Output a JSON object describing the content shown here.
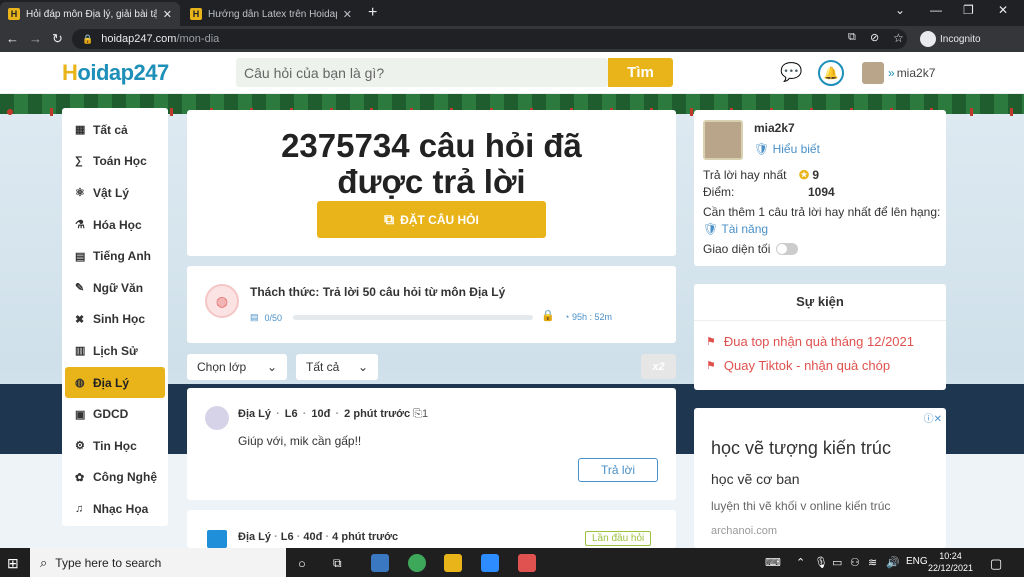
{
  "browser": {
    "tabs": [
      {
        "title": "Hỏi đáp môn Địa lý, giải bài tập môn Địa lý",
        "close": "✕"
      },
      {
        "title": "Hướng dẫn Latex trên Hoidap247",
        "close": "✕"
      }
    ],
    "new_tab": "+",
    "url_host": "hoidap247.com",
    "url_path": "/mon-dia",
    "profile_label": "Incognito"
  },
  "header": {
    "logo_h": "H",
    "logo_rest": "oidap247",
    "search_placeholder": "Câu hỏi của bạn là gì?",
    "search_button": "Tìm",
    "username": "mia2k7"
  },
  "sidebar": {
    "items": [
      {
        "label": "Tất cả",
        "icon": "grid-icon",
        "glyph": "▦"
      },
      {
        "label": "Toán Học",
        "icon": "math-icon",
        "glyph": "∑"
      },
      {
        "label": "Vật Lý",
        "icon": "physics-icon",
        "glyph": "⚛"
      },
      {
        "label": "Hóa Học",
        "icon": "flask-icon",
        "glyph": "⚗"
      },
      {
        "label": "Tiếng Anh",
        "icon": "english-icon",
        "glyph": "▤"
      },
      {
        "label": "Ngữ Văn",
        "icon": "pen-icon",
        "glyph": "✎"
      },
      {
        "label": "Sinh Học",
        "icon": "dna-icon",
        "glyph": "✖"
      },
      {
        "label": "Lịch Sử",
        "icon": "book-icon",
        "glyph": "▥"
      },
      {
        "label": "Địa Lý",
        "icon": "globe-icon",
        "glyph": "◍"
      },
      {
        "label": "GDCD",
        "icon": "civics-icon",
        "glyph": "▣"
      },
      {
        "label": "Tin Học",
        "icon": "computer-icon",
        "glyph": "⚙"
      },
      {
        "label": "Công Nghệ",
        "icon": "tech-icon",
        "glyph": "✿"
      },
      {
        "label": "Nhạc Họa",
        "icon": "music-icon",
        "glyph": "♫"
      }
    ],
    "active_index": 8
  },
  "hero": {
    "count_line1": "2375734 câu hỏi đã",
    "count_line2": "được trả lời",
    "ask_button": "ĐẶT CÂU HỎI"
  },
  "challenge": {
    "title": "Thách thức: Trả lời 50 câu hỏi  từ môn Địa Lý",
    "progress_text": "0/50",
    "progress": 0,
    "time_left": "95h : 52m"
  },
  "filters": {
    "grade": "Chọn lớp",
    "scope": "Tất cả",
    "multiplier": "x2"
  },
  "questions": [
    {
      "subject": "Địa Lý",
      "grade": "L6",
      "points": "10đ",
      "time": "2 phút trước",
      "attachments": "1",
      "text": "Giúp với, mik cần gấp!!",
      "reply_button": "Trả lời"
    },
    {
      "subject": "Địa Lý",
      "grade": "L6",
      "points": "40đ",
      "time": "4 phút trước",
      "badge": "Lần đầu hỏi"
    }
  ],
  "profile": {
    "name": "mia2k7",
    "badge": "Hiểu biết",
    "best_answers_label": "Trả lời hay nhất",
    "best_answers": "9",
    "points_label": "Điểm:",
    "points": "1094",
    "need_text": "Cần thêm 1 câu trả lời hay nhất để lên hạng:",
    "next_rank": "Tài năng",
    "dark_mode_label": "Giao diện tối",
    "dark_mode_on": false
  },
  "events": {
    "title": "Sự kiện",
    "items": [
      "Đua top nhận quà tháng 12/2021",
      "Quay Tiktok - nhận quà chóp"
    ]
  },
  "ad": {
    "headline": "học vẽ tượng kiến trúc",
    "line2": "học vẽ cơ ban",
    "line3": "luyện thi vẽ khối v online kiến trúc",
    "domain": "archanoi.com"
  },
  "taskbar": {
    "search_placeholder": "Type here to search",
    "lang": "ENG",
    "time": "10:24",
    "date": "22/12/2021"
  },
  "colors": {
    "accent": "#e8b41a",
    "brand_blue": "#1e8fb8",
    "event_red": "#e0524f"
  }
}
